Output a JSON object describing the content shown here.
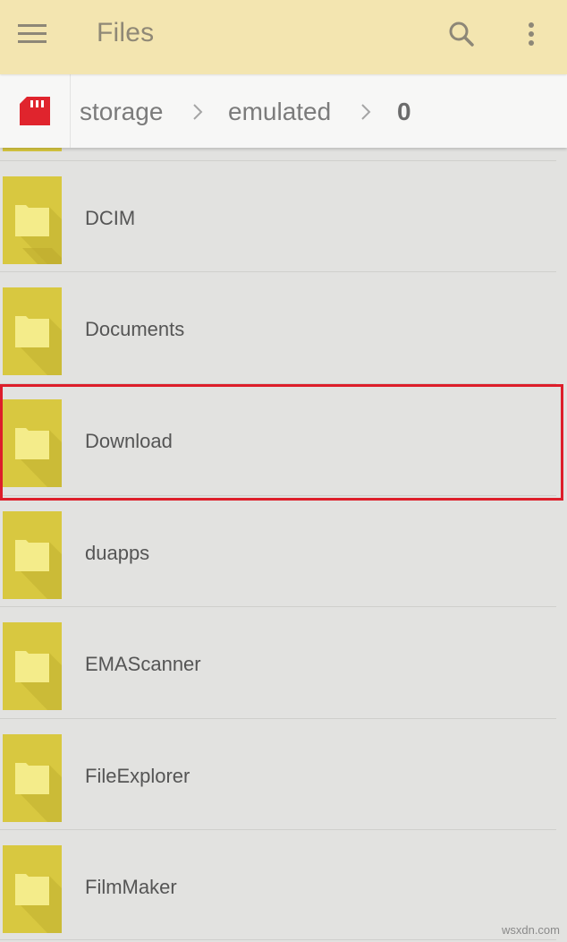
{
  "appbar": {
    "title": "Files",
    "menu_icon": "hamburger-menu-icon",
    "search_icon": "search-icon",
    "more_icon": "more-vertical-icon",
    "background": "#f3e5b0"
  },
  "breadcrumb": {
    "storage_icon": "sd-card-icon",
    "storage_icon_color": "#e0242d",
    "items": [
      {
        "label": "storage"
      },
      {
        "label": "emulated"
      },
      {
        "label": "0"
      }
    ]
  },
  "files": [
    {
      "name": "DCIM",
      "icon": "folder-icon"
    },
    {
      "name": "Documents",
      "icon": "folder-icon"
    },
    {
      "name": "Download",
      "icon": "folder-icon",
      "highlighted": true
    },
    {
      "name": "duapps",
      "icon": "folder-icon"
    },
    {
      "name": "EMAScanner",
      "icon": "folder-icon"
    },
    {
      "name": "FileExplorer",
      "icon": "folder-icon"
    },
    {
      "name": "FilmMaker",
      "icon": "folder-icon"
    }
  ],
  "highlight_color": "#dd1e2a",
  "folder_colors": {
    "tile": "#d8c840",
    "folder": "#f4ec8a",
    "shadow": "#bcaa2c"
  },
  "watermark": "wsxdn.com"
}
